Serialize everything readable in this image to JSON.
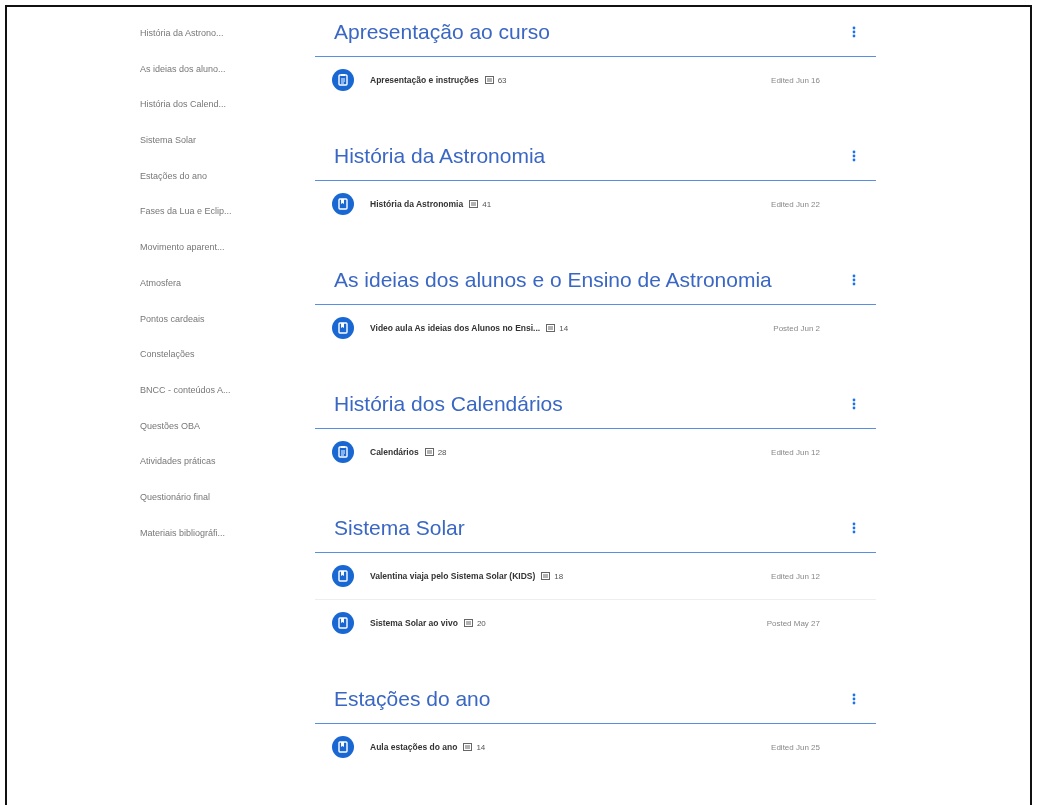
{
  "sidebar": {
    "items": [
      {
        "label": "História da Astrono..."
      },
      {
        "label": "As ideias dos aluno..."
      },
      {
        "label": "História dos Calend..."
      },
      {
        "label": "Sistema Solar"
      },
      {
        "label": "Estações do ano"
      },
      {
        "label": "Fases da Lua e Eclip..."
      },
      {
        "label": "Movimento aparent..."
      },
      {
        "label": "Atmosfera"
      },
      {
        "label": "Pontos cardeais"
      },
      {
        "label": "Constelações"
      },
      {
        "label": "BNCC - conteúdos A..."
      },
      {
        "label": "Questões OBA"
      },
      {
        "label": "Atividades práticas"
      },
      {
        "label": "Questionário final"
      },
      {
        "label": "Materiais bibliográfi..."
      }
    ]
  },
  "topics": [
    {
      "title": "Apresentação ao curso",
      "items": [
        {
          "kind": "assignment",
          "title": "Apresentação e instruções",
          "comments": "63",
          "date": "Edited Jun 16"
        }
      ]
    },
    {
      "title": "História da Astronomia",
      "items": [
        {
          "kind": "material",
          "title": "História da Astronomia",
          "comments": "41",
          "date": "Edited Jun 22"
        }
      ]
    },
    {
      "title": "As ideias dos alunos e o Ensino de Astronomia",
      "items": [
        {
          "kind": "material",
          "title": "Video aula As ideias dos Alunos no Ensi...",
          "comments": "14",
          "date": "Posted Jun 2"
        }
      ]
    },
    {
      "title": "História dos Calendários",
      "items": [
        {
          "kind": "assignment",
          "title": "Calendários",
          "comments": "28",
          "date": "Edited Jun 12"
        }
      ]
    },
    {
      "title": "Sistema Solar",
      "items": [
        {
          "kind": "material",
          "title": "Valentina viaja pelo Sistema Solar (KIDS)",
          "comments": "18",
          "date": "Edited Jun 12"
        },
        {
          "kind": "material",
          "title": "Sistema Solar ao vivo",
          "comments": "20",
          "date": "Posted May 27"
        }
      ]
    },
    {
      "title": "Estações do ano",
      "items": [
        {
          "kind": "material",
          "title": "Aula estações do ano",
          "comments": "14",
          "date": "Edited Jun 25"
        }
      ]
    }
  ]
}
